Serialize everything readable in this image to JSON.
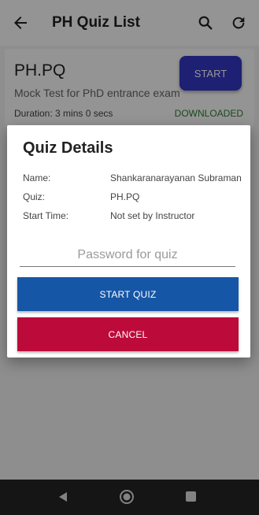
{
  "appbar": {
    "title": "PH Quiz List"
  },
  "quiz_card": {
    "name": "PH.PQ",
    "description": "Mock Test for PhD entrance exam",
    "duration": "Duration: 3 mins 0 secs",
    "status": "DOWNLOADED",
    "start_label": "START"
  },
  "dialog": {
    "title": "Quiz Details",
    "rows": [
      {
        "label": "Name:",
        "value": "Shankaranarayanan Subraman"
      },
      {
        "label": "Quiz:",
        "value": "PH.PQ"
      },
      {
        "label": "Start Time:",
        "value": "Not set by Instructor"
      }
    ],
    "password_placeholder": "Password for quiz",
    "start_quiz_label": "START QUIZ",
    "cancel_label": "CANCEL"
  },
  "colors": {
    "start_button": "#3438c9",
    "start_quiz_button": "#1656a6",
    "cancel_button": "#bc0b3a",
    "status": "#2e7d32"
  },
  "icons": {
    "back": "back-arrow-icon",
    "search": "search-icon",
    "refresh": "refresh-icon",
    "nav_back": "nav-back-icon",
    "nav_home": "nav-home-icon",
    "nav_recent": "nav-recent-icon"
  }
}
